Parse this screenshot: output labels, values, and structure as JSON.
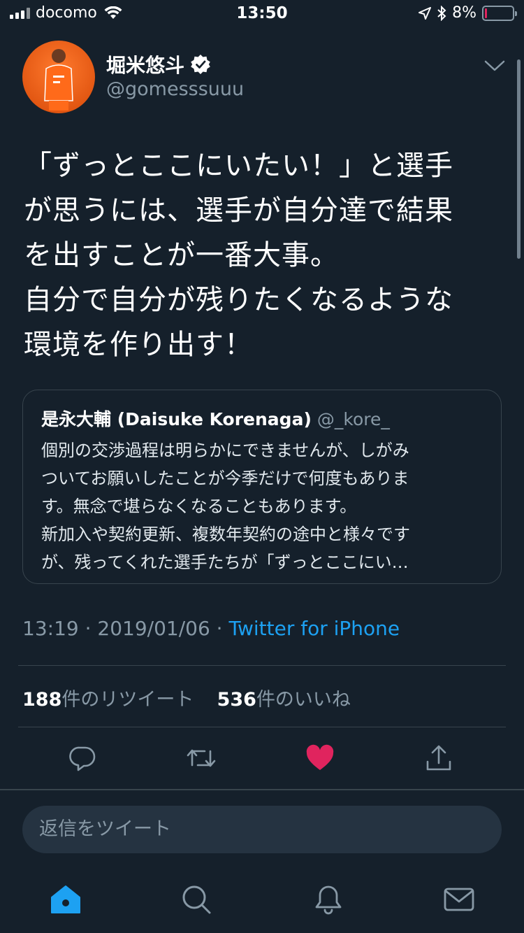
{
  "status_bar": {
    "carrier": "docomo",
    "time": "13:50",
    "battery_percent": "8%",
    "battery_level": 0.08
  },
  "tweet": {
    "author_name": "堀米悠斗",
    "author_handle": "@gomesssuuu",
    "verified": true,
    "text_lines": [
      "「ずっとここにいたい！」と選手",
      "が思うには、選手が自分達で結果",
      "を出すことが一番大事。",
      "自分で自分が残りたくなるような",
      "環境を作り出す！"
    ],
    "timestamp": "13:19 · 2019/01/06 · ",
    "source": "Twitter for iPhone",
    "retweets_count": "188",
    "retweets_label": "件のリツイート",
    "likes_count": "536",
    "likes_label": "件のいいね",
    "liked": true
  },
  "quoted_tweet": {
    "name": "是永大輔 (Daisuke Korenaga)",
    "handle": "@_kore_",
    "lines": [
      "個別の交渉過程は明らかにできませんが、しがみ",
      "ついてお願いしたことが今季だけで何度もありま",
      "す。無念で堪らなくなることもあります。",
      "新加入や契約更新、複数年契約の途中と様々です",
      "が、残ってくれた選手たちが「ずっとここにい…"
    ]
  },
  "reply": {
    "placeholder": "返信をツイート"
  },
  "icons": {
    "reply": "reply-icon",
    "retweet": "retweet-icon",
    "like": "heart-icon",
    "share": "share-icon",
    "home": "home-icon",
    "search": "search-icon",
    "notifications": "bell-icon",
    "messages": "mail-icon"
  },
  "colors": {
    "background": "#15202b",
    "accent": "#1da1f2",
    "like": "#e0245e",
    "secondary_text": "#8899a6"
  }
}
